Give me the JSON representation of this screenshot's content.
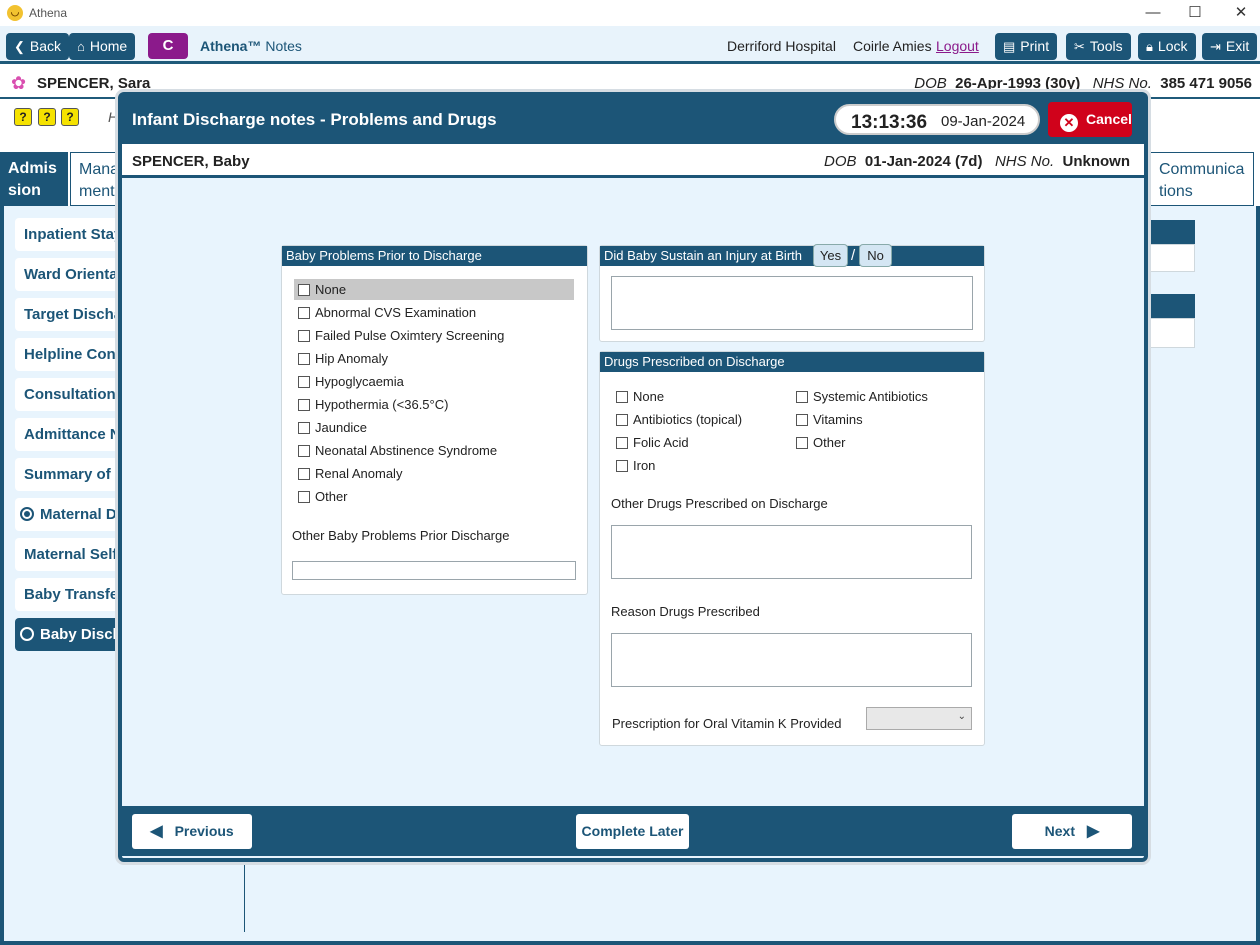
{
  "window": {
    "title": "Athena",
    "minimize": "—",
    "maximize": "☐",
    "close": "✕"
  },
  "toolbar": {
    "back": "Back",
    "home": "Home",
    "c_label": "C",
    "brand": "Athena™",
    "brand_suffix": "Notes",
    "hospital": "Derriford Hospital",
    "user": "Coirle Amies",
    "logout": "Logout",
    "print": "Print",
    "tools": "Tools",
    "lock": "Lock",
    "exit": "Exit"
  },
  "patient": {
    "name": "SPENCER, Sara",
    "dob_label": "DOB",
    "dob": "26-Apr-1993 (30y)",
    "nhs_label": "NHS No.",
    "nhs": "385 471 9056"
  },
  "background": {
    "h_label": "H",
    "tabs": [
      {
        "label": "Admis sion"
      },
      {
        "label": "Mana ment"
      },
      {
        "label": "Communica tions"
      }
    ],
    "nav": [
      {
        "label": "Inpatient Stay"
      },
      {
        "label": "Ward Orientat"
      },
      {
        "label": "Target Dischar"
      },
      {
        "label": "Helpline Cont"
      },
      {
        "label": "Consultation I"
      },
      {
        "label": "Admittance N"
      },
      {
        "label": "Summary of P"
      },
      {
        "label": "Maternal Di"
      },
      {
        "label": "Maternal Self"
      },
      {
        "label": "Baby Transfer"
      },
      {
        "label": "Baby Discha"
      }
    ]
  },
  "dialog": {
    "title": "Infant Discharge notes - Problems and Drugs",
    "time": "13:13:36",
    "date": "09-Jan-2024",
    "cancel": "Cancel",
    "baby": {
      "name": "SPENCER, Baby",
      "dob_label": "DOB",
      "dob": "01-Jan-2024 (7d)",
      "nhs_label": "NHS No.",
      "nhs": "Unknown"
    },
    "problems": {
      "header": "Baby Problems Prior to Discharge",
      "options": [
        "None",
        "Abnormal CVS Examination",
        "Failed Pulse Oximtery Screening",
        "Hip Anomaly",
        "Hypoglycaemia",
        "Hypothermia (<36.5°C)",
        "Jaundice",
        "Neonatal Abstinence Syndrome",
        "Renal Anomaly",
        "Other"
      ],
      "other_label": "Other Baby Problems Prior Discharge",
      "other_value": ""
    },
    "injury": {
      "header": "Did Baby Sustain an Injury at Birth",
      "yes": "Yes",
      "sep": "/",
      "no": "No",
      "value": ""
    },
    "drugs": {
      "header": "Drugs Prescribed on Discharge",
      "col1": [
        "None",
        "Antibiotics (topical)",
        "Folic Acid",
        "Iron"
      ],
      "col2": [
        "Systemic Antibiotics",
        "Vitamins",
        "Other"
      ],
      "other_label": "Other Drugs Prescribed on Discharge",
      "other_value": "",
      "reason_label": "Reason Drugs Prescribed",
      "reason_value": "",
      "vitk_label": "Prescription for Oral Vitamin K Provided",
      "vitk_value": ""
    },
    "footer": {
      "previous": "Previous",
      "complete_later": "Complete Later",
      "next": "Next"
    }
  }
}
